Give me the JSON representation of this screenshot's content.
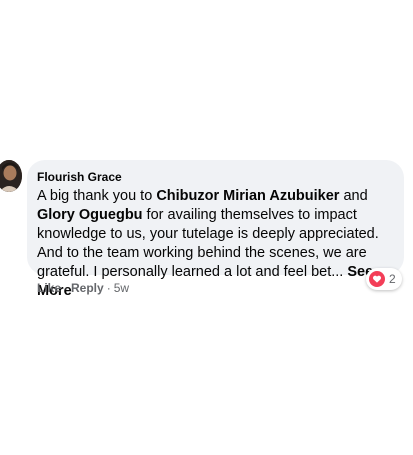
{
  "comment": {
    "author": "Flourish Grace",
    "text_parts": {
      "p1": "A big thank you to ",
      "mention1": "Chibuzor Mirian Azubuiker",
      "p2": " and ",
      "mention2": "Glory Oguegbu",
      "p3": " for availing themselves to impact knowledge to us, your tutelage is deeply appreciated. And to the team working behind the scenes, we are grateful. I personally learned a lot and feel bet... ",
      "see_more": "See More"
    },
    "reaction": {
      "icon": "heart-icon",
      "color": "#f33e58",
      "count": "2"
    },
    "actions": {
      "like": "Like",
      "dot1": "·",
      "reply": "Reply",
      "dot2": "·",
      "time": "5w"
    }
  }
}
